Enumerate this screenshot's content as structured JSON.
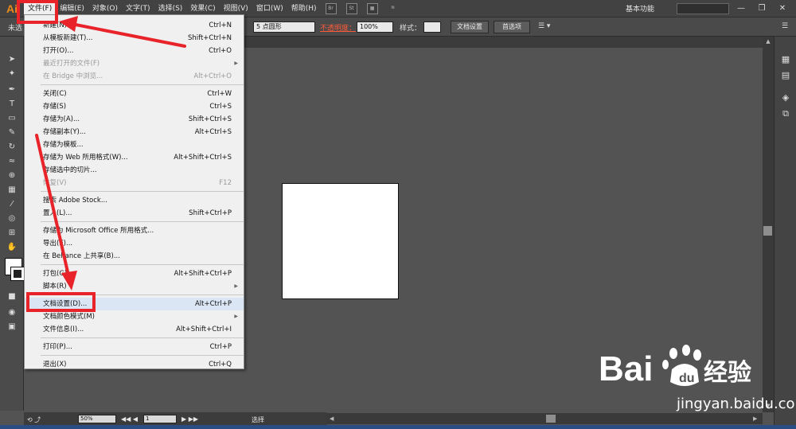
{
  "app": {
    "logo": "Ai"
  },
  "menubar": {
    "items": [
      "文件(F)",
      "编辑(E)",
      "对象(O)",
      "文字(T)",
      "选择(S)",
      "效果(C)",
      "视图(V)",
      "窗口(W)",
      "帮助(H)"
    ],
    "workspace": "基本功能",
    "window_buttons": [
      "—",
      "❐",
      "✕"
    ]
  },
  "controlbar": {
    "left_label": "未选",
    "brush_value": "5 点圆形",
    "opacity_label": "不透明度：",
    "opacity_value": "100%",
    "style_label": "样式：",
    "doc_setup_button": "文档设置",
    "preferences_button": "首选项"
  },
  "file_menu": {
    "items": [
      {
        "label": "新建(N)...",
        "shortcut": "Ctrl+N"
      },
      {
        "label": "从模板新建(T)...",
        "shortcut": "Shift+Ctrl+N"
      },
      {
        "label": "打开(O)...",
        "shortcut": "Ctrl+O"
      },
      {
        "label": "最近打开的文件(F)",
        "shortcut": "",
        "disabled": true,
        "submenu": true
      },
      {
        "label": "在 Bridge 中浏览...",
        "shortcut": "Alt+Ctrl+O",
        "disabled": true
      },
      {
        "label": "关闭(C)",
        "shortcut": "Ctrl+W"
      },
      {
        "label": "存储(S)",
        "shortcut": "Ctrl+S"
      },
      {
        "label": "存储为(A)...",
        "shortcut": "Shift+Ctrl+S"
      },
      {
        "label": "存储副本(Y)...",
        "shortcut": "Alt+Ctrl+S"
      },
      {
        "label": "存储为模板...",
        "shortcut": ""
      },
      {
        "label": "存储为 Web 所用格式(W)...",
        "shortcut": "Alt+Shift+Ctrl+S"
      },
      {
        "label": "存储选中的切片...",
        "shortcut": ""
      },
      {
        "label": "恢复(V)",
        "shortcut": "F12",
        "disabled": true
      },
      {
        "label": "搜索 Adobe Stock...",
        "shortcut": ""
      },
      {
        "label": "置入(L)...",
        "shortcut": "Shift+Ctrl+P"
      },
      {
        "label": "存储为 Microsoft Office 所用格式...",
        "shortcut": ""
      },
      {
        "label": "导出(E)...",
        "shortcut": ""
      },
      {
        "label": "在 Behance 上共享(B)...",
        "shortcut": ""
      },
      {
        "label": "打包(G)...",
        "shortcut": "Alt+Shift+Ctrl+P"
      },
      {
        "label": "脚本(R)",
        "shortcut": "",
        "submenu": true
      },
      {
        "label": "文档设置(D)...",
        "shortcut": "Alt+Ctrl+P",
        "highlighted": true
      },
      {
        "label": "文档颜色模式(M)",
        "shortcut": "",
        "submenu": true
      },
      {
        "label": "文件信息(I)...",
        "shortcut": "Alt+Shift+Ctrl+I"
      },
      {
        "label": "打印(P)...",
        "shortcut": "Ctrl+P"
      },
      {
        "label": "退出(X)",
        "shortcut": "Ctrl+Q"
      }
    ]
  },
  "statusbar": {
    "zoom": "50%",
    "artboard_number": "1",
    "mode_text": "选择"
  },
  "watermark": {
    "logo_text_latin": "Bai",
    "logo_text_cn": "经验",
    "url": "jingyan.baidu.com"
  },
  "colors": {
    "annotation_red": "#e8242a",
    "menu_highlight": "#dbe6f5",
    "ui_dark": "#424242",
    "canvas": "#535353",
    "brand_orange": "#e98a1c"
  }
}
